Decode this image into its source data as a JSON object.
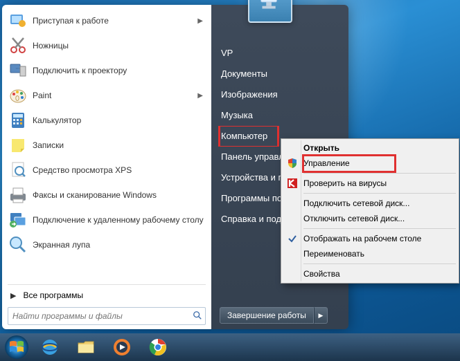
{
  "user_name": "VP",
  "programs": [
    {
      "label": "Приступая к работе",
      "icon": "getting-started",
      "arrow": true
    },
    {
      "label": "Ножницы",
      "icon": "snipping",
      "arrow": false
    },
    {
      "label": "Подключить к проектору",
      "icon": "projector",
      "arrow": false
    },
    {
      "label": "Paint",
      "icon": "paint",
      "arrow": true
    },
    {
      "label": "Калькулятор",
      "icon": "calculator",
      "arrow": false
    },
    {
      "label": "Записки",
      "icon": "sticky",
      "arrow": false
    },
    {
      "label": "Средство просмотра XPS",
      "icon": "xps",
      "arrow": false
    },
    {
      "label": "Факсы и сканирование Windows",
      "icon": "fax",
      "arrow": false
    },
    {
      "label": "Подключение к удаленному рабочему столу",
      "icon": "remote",
      "arrow": false
    },
    {
      "label": "Экранная лупа",
      "icon": "magnifier",
      "arrow": false
    }
  ],
  "all_programs_label": "Все программы",
  "search_placeholder": "Найти программы и файлы",
  "right_items": [
    {
      "label": "VP",
      "key": "user"
    },
    {
      "label": "Документы",
      "key": "documents"
    },
    {
      "label": "Изображения",
      "key": "pictures"
    },
    {
      "label": "Музыка",
      "key": "music"
    },
    {
      "label": "Компьютер",
      "key": "computer",
      "highlight": true
    },
    {
      "label": "Панель управления",
      "key": "control"
    },
    {
      "label": "Устройства и принтеры",
      "key": "devices"
    },
    {
      "label": "Программы по умолчанию",
      "key": "defaults"
    },
    {
      "label": "Справка и поддержка",
      "key": "help"
    }
  ],
  "shutdown_label": "Завершение работы",
  "context_menu": [
    {
      "label": "Открыть",
      "bold": true,
      "icon": ""
    },
    {
      "label": "Управление",
      "icon": "shield",
      "highlight": true
    },
    {
      "sep": true
    },
    {
      "label": "Проверить на вирусы",
      "icon": "kaspersky"
    },
    {
      "sep": true
    },
    {
      "label": "Подключить сетевой диск...",
      "icon": ""
    },
    {
      "label": "Отключить сетевой диск...",
      "icon": ""
    },
    {
      "sep": true
    },
    {
      "label": "Отображать на рабочем столе",
      "icon": "check"
    },
    {
      "label": "Переименовать",
      "icon": ""
    },
    {
      "sep": true
    },
    {
      "label": "Свойства",
      "icon": ""
    }
  ],
  "highlight_color": "#e03030"
}
